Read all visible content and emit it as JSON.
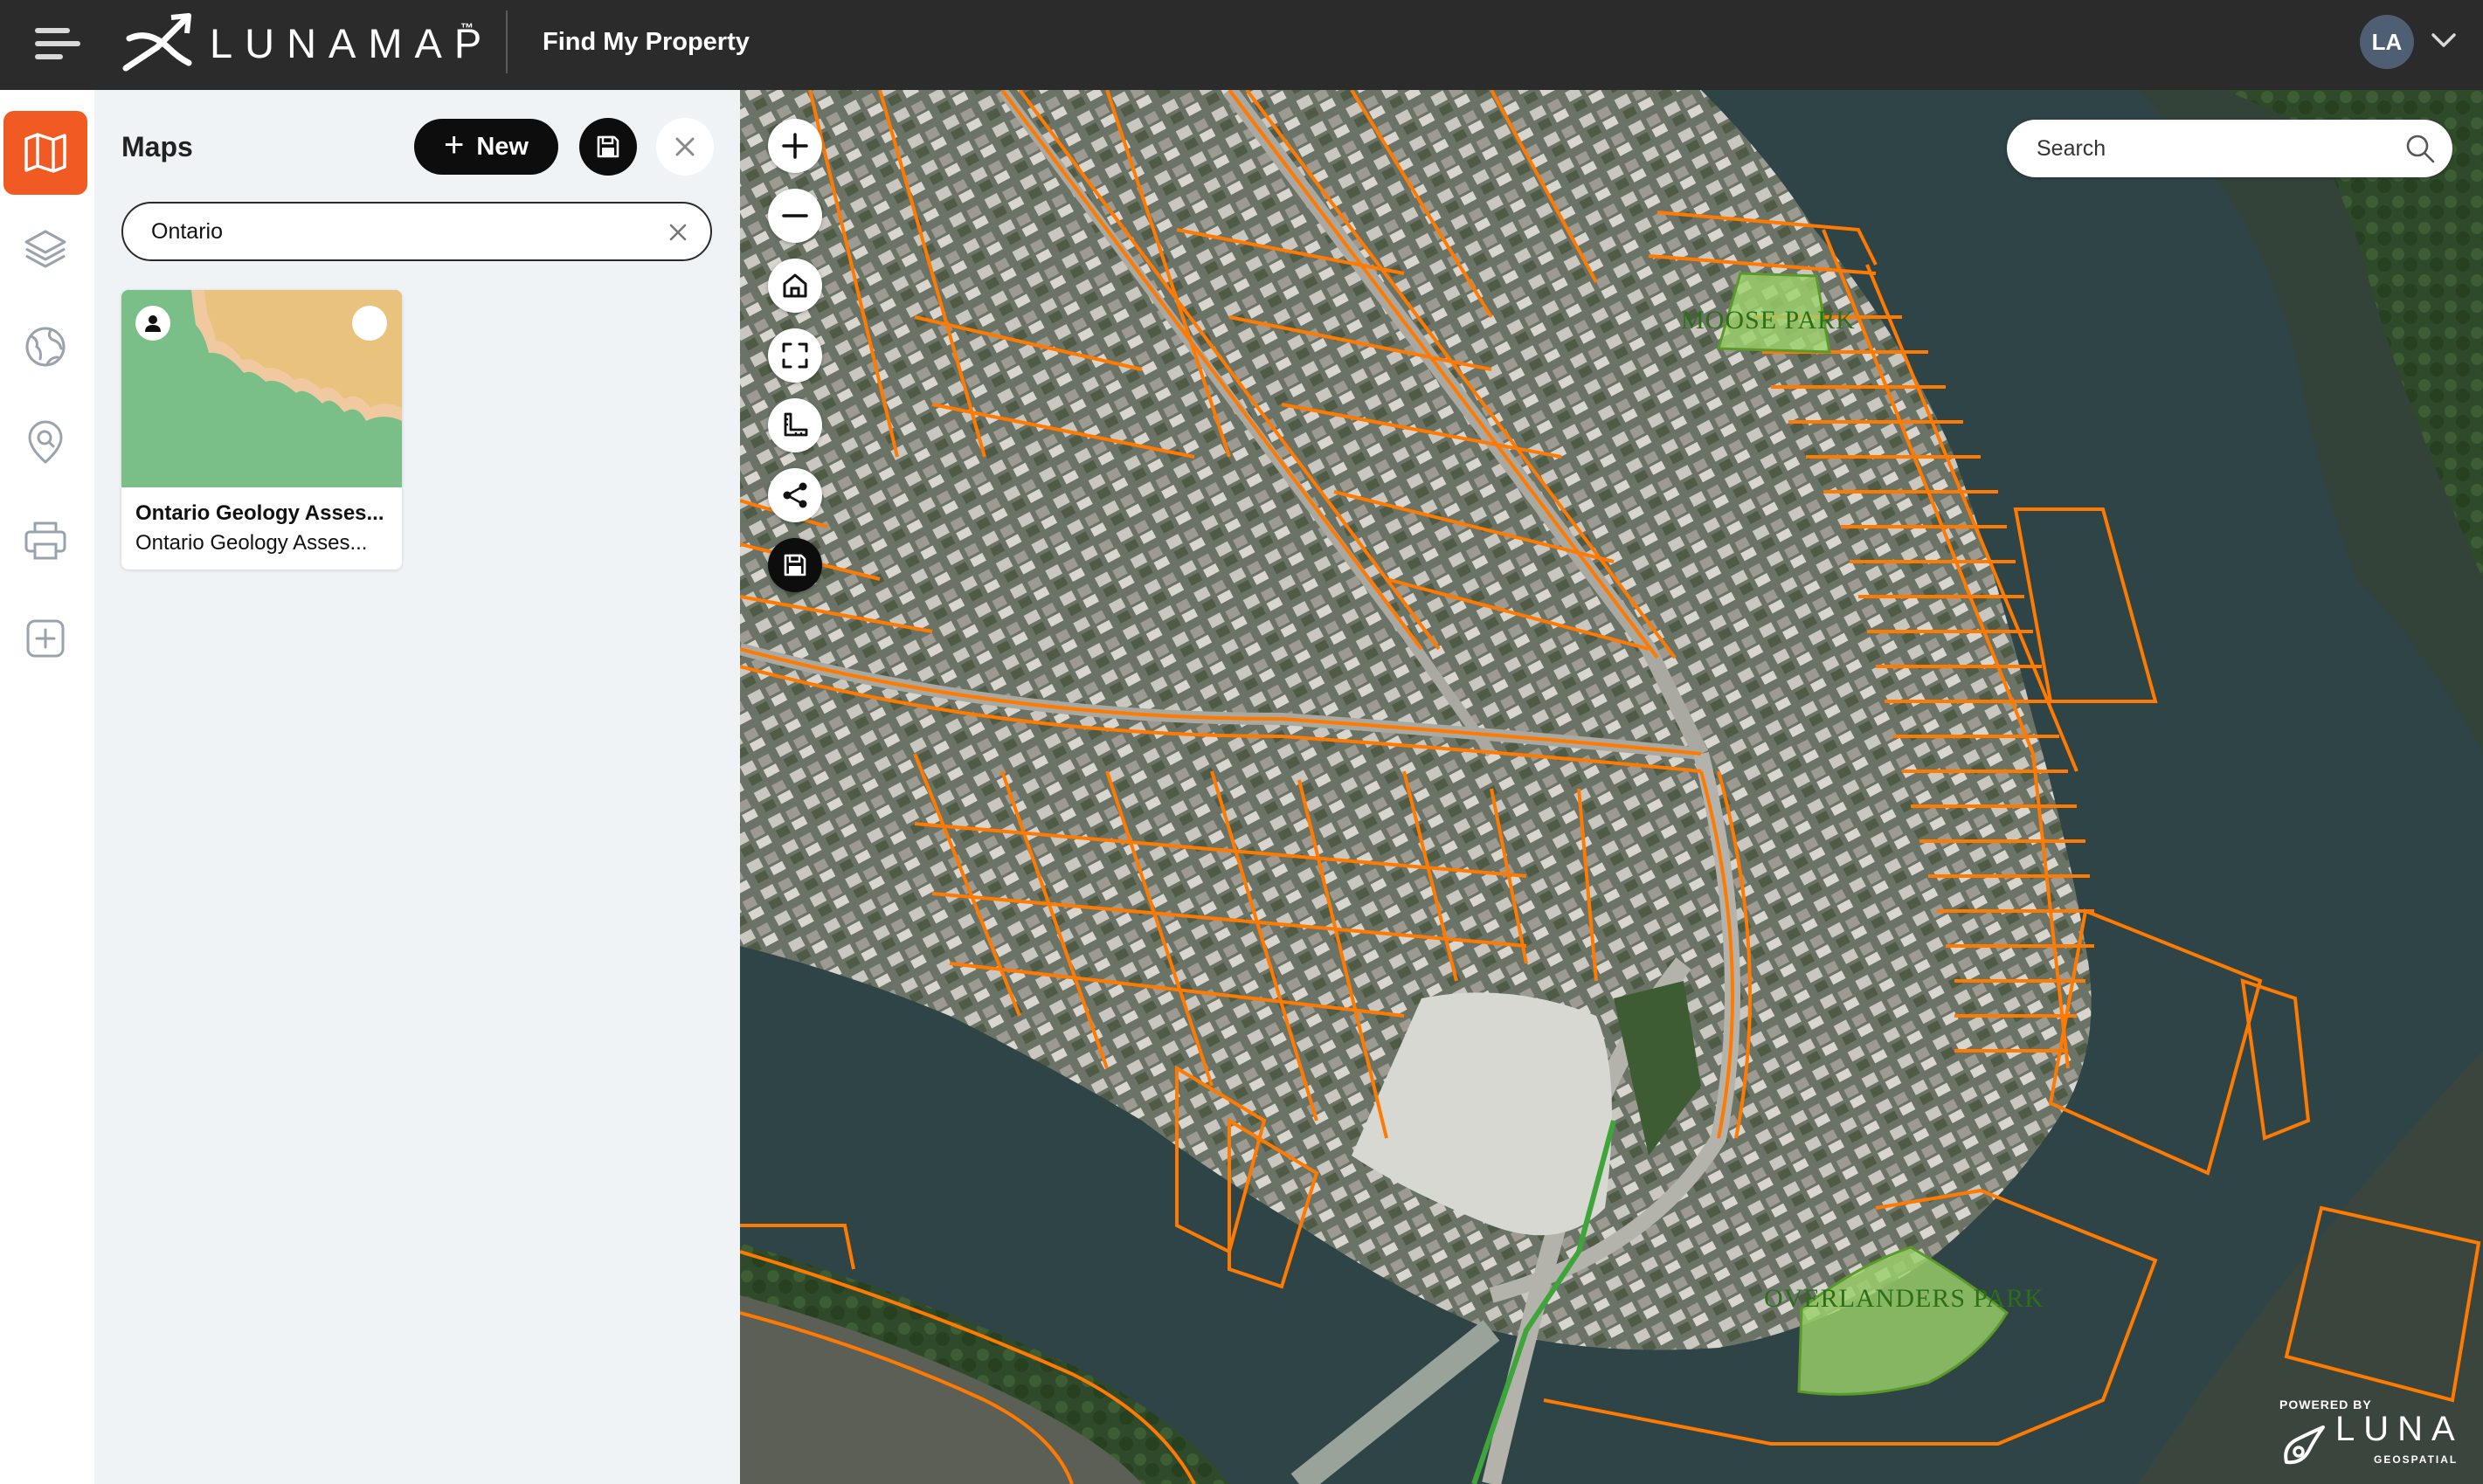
{
  "header": {
    "logo_text": "LUNAMAP",
    "logo_tm": "™",
    "app_title": "Find My Property",
    "user_initials": "LA"
  },
  "rail": {
    "items": [
      {
        "name": "maps",
        "icon": "map-icon",
        "active": true
      },
      {
        "name": "layers",
        "icon": "layers-icon",
        "active": false
      },
      {
        "name": "basemaps",
        "icon": "globe-icon",
        "active": false
      },
      {
        "name": "search",
        "icon": "search-location-icon",
        "active": false
      },
      {
        "name": "print",
        "icon": "printer-icon",
        "active": false
      },
      {
        "name": "add",
        "icon": "add-square-icon",
        "active": false
      }
    ]
  },
  "panel": {
    "title": "Maps",
    "new_label": "New",
    "search_value": "Ontario",
    "cards": [
      {
        "title": "Ontario Geology Asses...",
        "subtitle": "Ontario Geology Asses..."
      }
    ]
  },
  "map": {
    "search_placeholder": "Search",
    "parks": [
      "MOOSE PARK",
      "OVERLANDERS PARK"
    ],
    "powered_by": "POWERED BY",
    "powered_name": "LUNA",
    "powered_sub": "GEOSPATIAL"
  },
  "colors": {
    "accent": "#f15a22",
    "topbar": "#2b2b2b",
    "parcel": "#ff7a00",
    "park_fill": "#9ed36a",
    "water": "#2e4447"
  }
}
